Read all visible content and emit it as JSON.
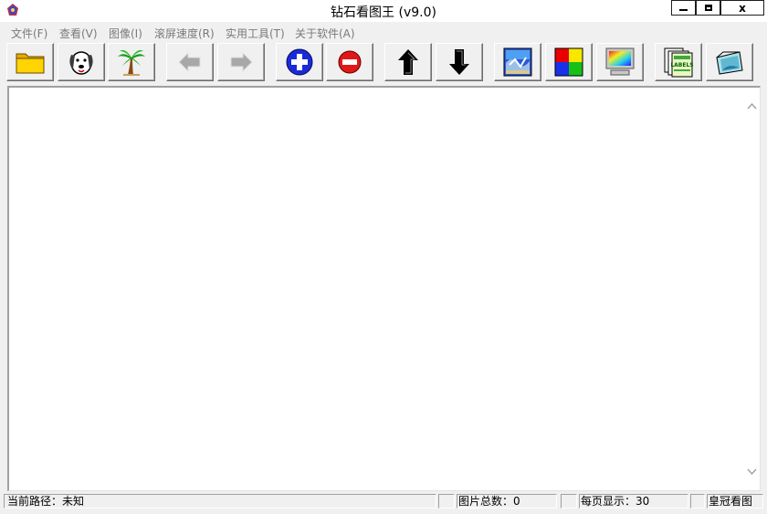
{
  "window": {
    "title": "钻石看图王 (v9.0)",
    "close_glyph": "x"
  },
  "menu": {
    "items": [
      {
        "label": "文件(F)"
      },
      {
        "label": "查看(V)"
      },
      {
        "label": "图像(I)"
      },
      {
        "label": "滚屏速度(R)"
      },
      {
        "label": "实用工具(T)"
      },
      {
        "label": "关于软件(A)"
      }
    ]
  },
  "toolbar": {
    "buttons": [
      {
        "icon": "folder-icon"
      },
      {
        "icon": "dog-icon"
      },
      {
        "icon": "palm-tree-icon"
      },
      {
        "icon": "arrow-left-icon",
        "disabled": true
      },
      {
        "icon": "arrow-right-icon",
        "disabled": true
      },
      {
        "icon": "zoom-in-icon"
      },
      {
        "icon": "zoom-out-icon"
      },
      {
        "icon": "arrow-up-icon"
      },
      {
        "icon": "arrow-down-icon"
      },
      {
        "icon": "image-effect-icon"
      },
      {
        "icon": "color-grid-icon"
      },
      {
        "icon": "monitor-icon"
      },
      {
        "icon": "labels-icon",
        "text": "LABELS"
      },
      {
        "icon": "photo-frame-icon"
      }
    ]
  },
  "statusbar": {
    "path_text": "当前路径：未知",
    "total_text": "图片总数：0",
    "per_page_text": "每页显示：30",
    "brand_text": "皇冠看图"
  }
}
